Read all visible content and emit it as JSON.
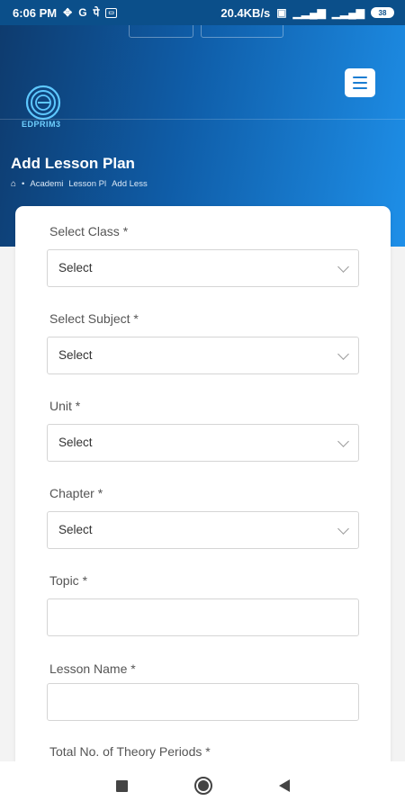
{
  "status_bar": {
    "time": "6:06 PM",
    "left_icons": [
      "grid-icon",
      "g-icon",
      "pe-icon",
      "app-icon"
    ],
    "network_speed": "20.4KB/s",
    "battery": "38"
  },
  "app": {
    "logo_text": "EDPRIM3",
    "page_title": "Add Lesson Plan",
    "breadcrumb": [
      "Academi",
      "Lesson Pl",
      "Add Less"
    ],
    "accent_color": "#1b7dd2"
  },
  "form": {
    "fields": [
      {
        "label": "Select Class *",
        "value": "Select",
        "type": "select"
      },
      {
        "label": "Select Subject *",
        "value": "Select",
        "type": "select"
      },
      {
        "label": "Unit *",
        "value": "Select",
        "type": "select"
      },
      {
        "label": "Chapter *",
        "value": "Select",
        "type": "select"
      },
      {
        "label": "Topic *",
        "value": "",
        "type": "text"
      },
      {
        "label": "Lesson Name *",
        "value": "",
        "type": "text"
      },
      {
        "label": "Total No. of Theory Periods *",
        "value": "",
        "type": "text"
      }
    ]
  }
}
